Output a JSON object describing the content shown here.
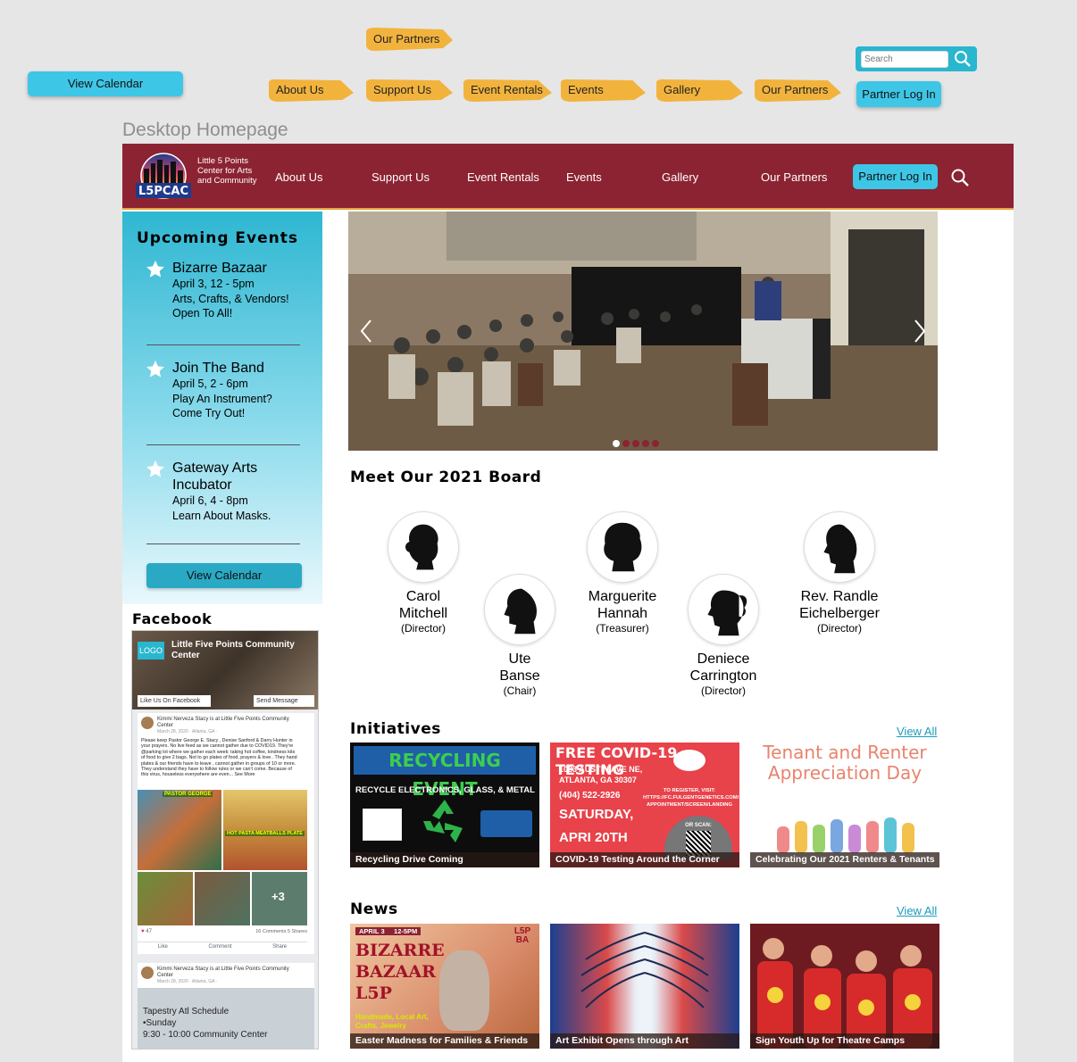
{
  "annotations": {
    "top_partners": "Our Partners",
    "view_calendar": "View Calendar",
    "menu": [
      "About Us",
      "Support Us",
      "Event Rentals",
      "Events",
      "Gallery",
      "Our Partners"
    ],
    "search_placeholder": "Search",
    "partner_login": "Partner Log In",
    "board_label": "Desktop Homepage"
  },
  "colors": {
    "brand": "#8b2332",
    "accent": "#3ec6e6",
    "highlight": "#f2b33d"
  },
  "nav": {
    "logo_text": "L5PCAC",
    "logo_sub": "Little 5 Points Center for Arts and Community",
    "links": [
      "About Us",
      "Support Us",
      "Event Rentals",
      "Events",
      "Gallery",
      "Our Partners"
    ],
    "login": "Partner Log In",
    "search_icon": "search-icon"
  },
  "sidebar": {
    "title": "Upcoming Events",
    "events": [
      {
        "title": "Bizarre Bazaar",
        "lines": [
          "April 3, 12 - 5pm",
          "Arts, Crafts, & Vendors!",
          "Open To All!"
        ]
      },
      {
        "title": "Join The Band",
        "lines": [
          "April 5, 2 - 6pm",
          "Play An Instrument?",
          "Come Try Out!"
        ]
      },
      {
        "title": "Gateway Arts Incubator",
        "lines": [
          "April 6, 4 - 8pm",
          "Learn About Masks."
        ]
      }
    ],
    "calendar_button": "View Calendar"
  },
  "facebook": {
    "title": "Facebook",
    "logo": "LOGO",
    "page_name": "Little Five Points Community Center",
    "like": "Like Us On Facebook",
    "message": "Send Message",
    "post1": {
      "author": "Kimmi Nerveza Stacy is at Little Five Points Community Center",
      "date": "March 28, 2020 · Atlanta, GA ·",
      "body": "Please keep Pastor George E. Stacy , Denise Sanford & Darry Hunter in your prayers. No live feed as we cannot gather due to COVID19. They're @parking lot where we gather each week: taking hot coffee, kindness kits of food to give 2 bags. Not to go plates of food, prayers & love.. They hand plates & our friends have to leave , cannot gather in groups of 10 or more. They understand they have to follow rules or we can't come. Because of this virus, houseless everywhere are even... See More",
      "photo_labels": [
        "PASTOR GEORGE",
        "HOT PASTA MEATBALLS PLATE",
        "+3"
      ],
      "reactions": "47",
      "stats": "16 Comments 5 Shares",
      "actions": [
        "Like",
        "Comment",
        "Share"
      ]
    },
    "post2": {
      "author": "Kimmi Nerveza Stacy is at Little Five Points Community Center",
      "date": "March 28, 2020 · Atlanta, GA ·",
      "image_lines": [
        "Tapestry Atl Schedule",
        "•Sunday",
        "9:30 - 10:00 Community Center"
      ]
    }
  },
  "board": {
    "title": "Meet Our 2021 Board",
    "members": [
      {
        "name": "Carol Mitchell",
        "role": "(Director)"
      },
      {
        "name": "Ute Banse",
        "role": "(Chair)"
      },
      {
        "name": "Marguerite Hannah",
        "role": "(Treasurer)"
      },
      {
        "name": "Deniece Carrington",
        "role": "(Director)"
      },
      {
        "name": "Rev. Randle Eichelberger",
        "role": "(Director)"
      }
    ]
  },
  "initiatives": {
    "title": "Initiatives",
    "view_all": "View All",
    "cards": [
      {
        "headline": "RECYCLING EVENT",
        "sub": "RECYCLE ELECTRONICS, GLASS, & METAL",
        "caption": "Recycling Drive Coming"
      },
      {
        "headline": "FREE COVID-19 TESTING",
        "address": "1083 AUSTIN AVE NE, ATLANTA, GA 30307",
        "phone": "(404) 522-2926",
        "day": "SATURDAY,",
        "date": "APRI 20TH",
        "register": "TO REGISTER, VISIT: HTTPS://FC.FULGENTGENETICS.COM/ APPOINTMENT/SCREEN/LANDING",
        "scan": "OR SCAN:",
        "caption": "COVID-19 Testing Around the Corner"
      },
      {
        "headline": "Tenant and Renter Appreciation Day",
        "caption": "Celebrating Our 2021 Renters & Tenants"
      }
    ]
  },
  "news": {
    "title": "News",
    "view_all": "View All",
    "cards": [
      {
        "date": "APRIL 3",
        "time": "12-5PM",
        "headline": "BIZARRE BAZAAR L5P",
        "tag": "Handmade, Local Art, Crafts, Jewelry",
        "badge": "L5P BA",
        "caption": "Easter Madness for Families & Friends"
      },
      {
        "caption": "Art Exhibit Opens through Art"
      },
      {
        "caption": "Sign Youth Up for Theatre Camps"
      }
    ]
  }
}
